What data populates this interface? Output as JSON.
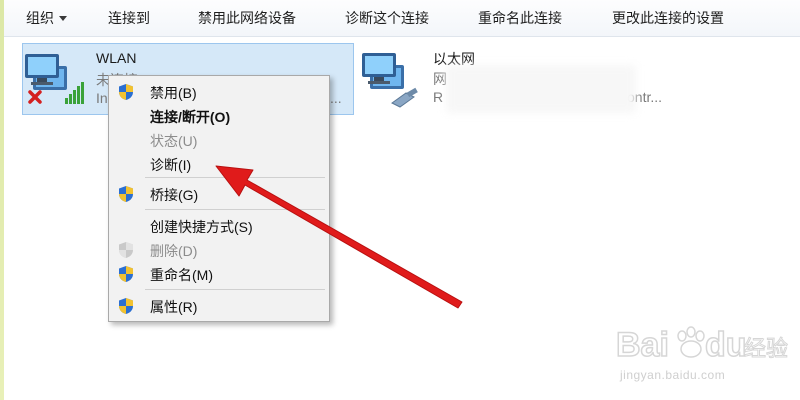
{
  "toolbar": {
    "organize": "组织",
    "connect_to": "连接到",
    "disable_device": "禁用此网络设备",
    "diagnose": "诊断这个连接",
    "rename": "重命名此连接",
    "change_settings": "更改此连接的设置"
  },
  "adapters": {
    "wlan": {
      "name": "WLAN",
      "status": "未连接",
      "device_prefix": "In",
      "device_suffix": "..."
    },
    "ethernet": {
      "name": "以太网",
      "status_prefix": "网",
      "device_prefix": "R",
      "device_suffix": "ontr..."
    }
  },
  "context_menu": {
    "items": [
      {
        "label": "禁用(B)",
        "icon": "shield-icon"
      },
      {
        "label": "连接/断开(O)"
      },
      {
        "label": "状态(U)"
      },
      {
        "label": "诊断(I)"
      },
      {
        "label": "桥接(G)",
        "icon": "shield-icon"
      },
      {
        "label": "创建快捷方式(S)"
      },
      {
        "label": "删除(D)",
        "icon": "shield-icon-disabled"
      },
      {
        "label": "重命名(M)",
        "icon": "shield-icon"
      },
      {
        "label": "属性(R)",
        "icon": "shield-icon"
      }
    ]
  },
  "annotation": {
    "color": "#e01b1b",
    "points_to": "诊断(I)"
  },
  "watermark": {
    "logo": "Baidu经验",
    "text": "jingyan.baidu.com"
  },
  "colors": {
    "selection_bg": "#d5e8f8",
    "selection_border": "#9cc6ee",
    "menu_bg": "#f2f2f2"
  }
}
